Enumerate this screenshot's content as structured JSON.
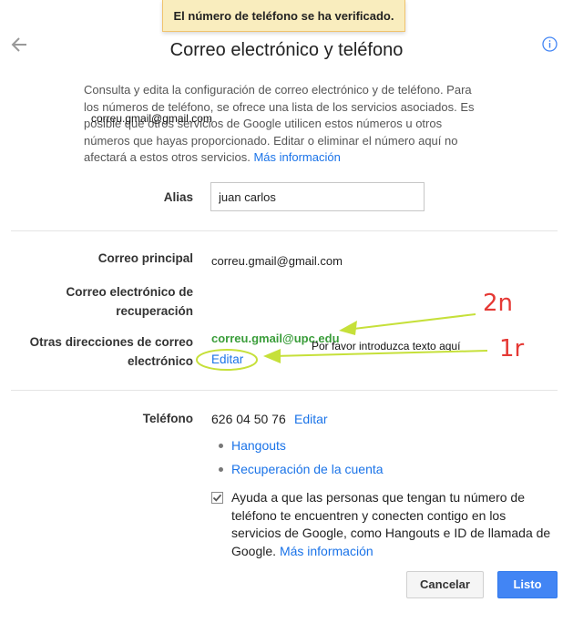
{
  "toast": {
    "text": "El número de teléfono se ha verificado."
  },
  "header": {
    "title": "Correo electrónico y teléfono"
  },
  "intro": {
    "text": "Consulta y edita la configuración de correo electrónico y de teléfono. Para los números de teléfono, se ofrece una lista de los servicios asociados. Es posible que otros servicios de Google utilicen estos números u otros números que hayas proporcionado. Editar o eliminar el número aquí no afectará a estos otros servicios.",
    "link": "Más información",
    "overlay_email": "correu.gmail@gmail.com"
  },
  "alias": {
    "label": "Alias",
    "value": "juan carlos"
  },
  "primary_email": {
    "label": "Correo principal",
    "value": "correu.gmail@gmail.com"
  },
  "recovery_email": {
    "label_line1": "Correo electrónico de",
    "label_line2": "recuperación"
  },
  "other_emails": {
    "label_line1": "Otras direcciones de correo",
    "label_line2": "electrónico",
    "value": "correu.gmail@upc.edu",
    "edit": "Editar",
    "ghost_text": "Por favor introduzca texto aquí"
  },
  "annotations": {
    "a": "2n",
    "b": "1r"
  },
  "phone": {
    "label": "Teléfono",
    "number": "626 04 50 76",
    "edit": "Editar",
    "services": [
      "Hangouts",
      "Recuperación de la cuenta"
    ],
    "help_line1": "Ayuda a que las personas que tengan tu número de",
    "help_line2": "teléfono te encuentren y conecten contigo en los",
    "help_line3": "servicios de Google, como Hangouts e ID de llamada de",
    "help_line4": "Google.",
    "help_link": "Más información",
    "checked": true
  },
  "actions": {
    "cancel": "Cancelar",
    "done": "Listo"
  },
  "colors": {
    "link": "#1a73e8",
    "primary_button": "#4285f4",
    "toast_bg": "#f9edbe",
    "annotation": "#e53935",
    "highlight_green": "#c6e03a"
  }
}
